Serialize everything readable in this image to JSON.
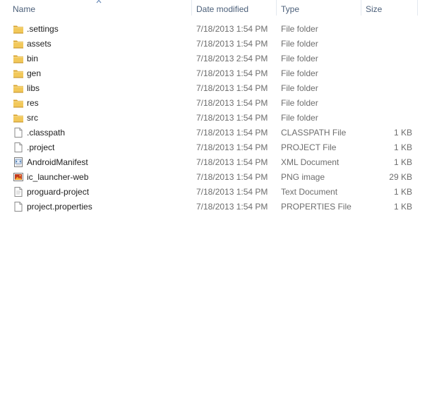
{
  "columns": {
    "name": "Name",
    "date_modified": "Date modified",
    "type": "Type",
    "size": "Size"
  },
  "sort": {
    "column": "name",
    "direction": "ascending",
    "icon": "sort-ascending-icon"
  },
  "colors": {
    "header_text": "#4c607a",
    "name_text": "#1e1e1e",
    "detail_text": "#6d6d6d",
    "folder": "#e8b94a"
  },
  "files": [
    {
      "name": ".settings",
      "date": "7/18/2013 1:54 PM",
      "type": "File folder",
      "size": "",
      "icon": "folder-icon"
    },
    {
      "name": "assets",
      "date": "7/18/2013 1:54 PM",
      "type": "File folder",
      "size": "",
      "icon": "folder-icon"
    },
    {
      "name": "bin",
      "date": "7/18/2013 2:54 PM",
      "type": "File folder",
      "size": "",
      "icon": "folder-icon"
    },
    {
      "name": "gen",
      "date": "7/18/2013 1:54 PM",
      "type": "File folder",
      "size": "",
      "icon": "folder-icon"
    },
    {
      "name": "libs",
      "date": "7/18/2013 1:54 PM",
      "type": "File folder",
      "size": "",
      "icon": "folder-icon"
    },
    {
      "name": "res",
      "date": "7/18/2013 1:54 PM",
      "type": "File folder",
      "size": "",
      "icon": "folder-icon"
    },
    {
      "name": "src",
      "date": "7/18/2013 1:54 PM",
      "type": "File folder",
      "size": "",
      "icon": "folder-icon"
    },
    {
      "name": ".classpath",
      "date": "7/18/2013 1:54 PM",
      "type": "CLASSPATH File",
      "size": "1 KB",
      "icon": "blank-file-icon"
    },
    {
      "name": ".project",
      "date": "7/18/2013 1:54 PM",
      "type": "PROJECT File",
      "size": "1 KB",
      "icon": "blank-file-icon"
    },
    {
      "name": "AndroidManifest",
      "date": "7/18/2013 1:54 PM",
      "type": "XML Document",
      "size": "1 KB",
      "icon": "xml-file-icon"
    },
    {
      "name": "ic_launcher-web",
      "date": "7/18/2013 1:54 PM",
      "type": "PNG image",
      "size": "29 KB",
      "icon": "image-file-icon"
    },
    {
      "name": "proguard-project",
      "date": "7/18/2013 1:54 PM",
      "type": "Text Document",
      "size": "1 KB",
      "icon": "text-file-icon"
    },
    {
      "name": "project.properties",
      "date": "7/18/2013 1:54 PM",
      "type": "PROPERTIES File",
      "size": "1 KB",
      "icon": "blank-file-icon"
    }
  ]
}
